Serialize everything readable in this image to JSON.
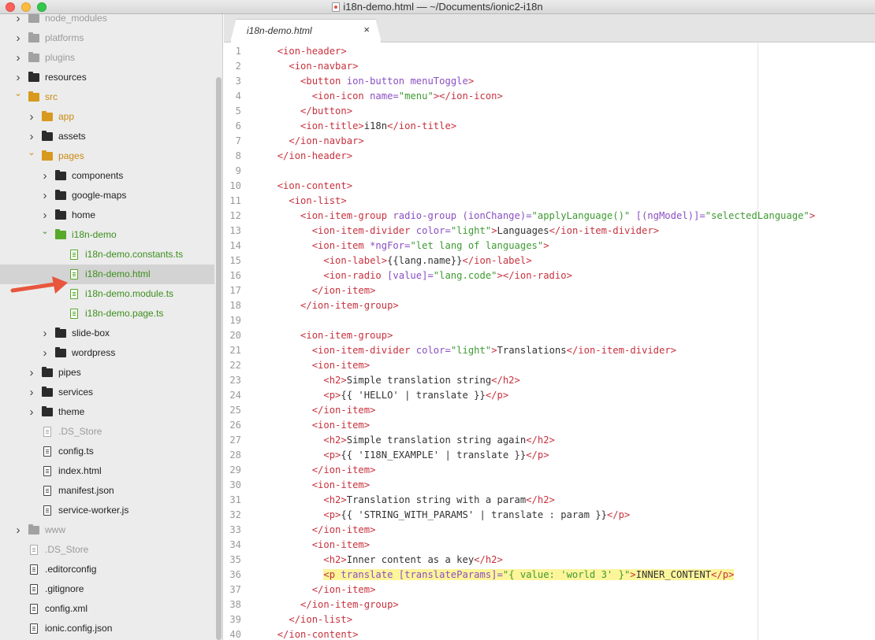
{
  "window": {
    "title": "i18n-demo.html — ~/Documents/ionic2-i18n"
  },
  "sidebar": {
    "items": [
      {
        "label": "node_modules",
        "kind": "folder",
        "color": "grey",
        "depth": 1,
        "chevron": "right"
      },
      {
        "label": "platforms",
        "kind": "folder",
        "color": "grey",
        "depth": 1,
        "chevron": "right"
      },
      {
        "label": "plugins",
        "kind": "folder",
        "color": "grey",
        "depth": 1,
        "chevron": "right"
      },
      {
        "label": "resources",
        "kind": "folder",
        "color": "dark",
        "depth": 1,
        "chevron": "right"
      },
      {
        "label": "src",
        "kind": "folder",
        "color": "gold",
        "depth": 1,
        "chevron": "down"
      },
      {
        "label": "app",
        "kind": "folder",
        "color": "gold",
        "depth": 2,
        "chevron": "right"
      },
      {
        "label": "assets",
        "kind": "folder",
        "color": "dark",
        "depth": 2,
        "chevron": "right"
      },
      {
        "label": "pages",
        "kind": "folder",
        "color": "gold",
        "depth": 2,
        "chevron": "down"
      },
      {
        "label": "components",
        "kind": "folder",
        "color": "dark",
        "depth": 3,
        "chevron": "right"
      },
      {
        "label": "google-maps",
        "kind": "folder",
        "color": "dark",
        "depth": 3,
        "chevron": "right"
      },
      {
        "label": "home",
        "kind": "folder",
        "color": "dark",
        "depth": 3,
        "chevron": "right"
      },
      {
        "label": "i18n-demo",
        "kind": "folder",
        "color": "green",
        "depth": 3,
        "chevron": "down"
      },
      {
        "label": "i18n-demo.constants.ts",
        "kind": "file",
        "color": "green",
        "depth": 4
      },
      {
        "label": "i18n-demo.html",
        "kind": "file",
        "color": "green",
        "depth": 4,
        "selected": true
      },
      {
        "label": "i18n-demo.module.ts",
        "kind": "file",
        "color": "green",
        "depth": 4
      },
      {
        "label": "i18n-demo.page.ts",
        "kind": "file",
        "color": "green",
        "depth": 4
      },
      {
        "label": "slide-box",
        "kind": "folder",
        "color": "dark",
        "depth": 3,
        "chevron": "right"
      },
      {
        "label": "wordpress",
        "kind": "folder",
        "color": "dark",
        "depth": 3,
        "chevron": "right"
      },
      {
        "label": "pipes",
        "kind": "folder",
        "color": "dark",
        "depth": 2,
        "chevron": "right"
      },
      {
        "label": "services",
        "kind": "folder",
        "color": "dark",
        "depth": 2,
        "chevron": "right"
      },
      {
        "label": "theme",
        "kind": "folder",
        "color": "dark",
        "depth": 2,
        "chevron": "right"
      },
      {
        "label": ".DS_Store",
        "kind": "file",
        "color": "grey",
        "depth": 2
      },
      {
        "label": "config.ts",
        "kind": "file",
        "color": "dark",
        "depth": 2
      },
      {
        "label": "index.html",
        "kind": "file",
        "color": "dark",
        "depth": 2
      },
      {
        "label": "manifest.json",
        "kind": "file",
        "color": "dark",
        "depth": 2
      },
      {
        "label": "service-worker.js",
        "kind": "file",
        "color": "dark",
        "depth": 2
      },
      {
        "label": "www",
        "kind": "folder",
        "color": "grey",
        "depth": 1,
        "chevron": "right"
      },
      {
        "label": ".DS_Store",
        "kind": "file",
        "color": "grey",
        "depth": 1
      },
      {
        "label": ".editorconfig",
        "kind": "file",
        "color": "dark",
        "depth": 1
      },
      {
        "label": ".gitignore",
        "kind": "file",
        "color": "dark",
        "depth": 1
      },
      {
        "label": "config.xml",
        "kind": "file",
        "color": "dark",
        "depth": 1
      },
      {
        "label": "ionic.config.json",
        "kind": "file",
        "color": "dark",
        "depth": 1
      }
    ]
  },
  "tabs": [
    {
      "label": "i18n-demo.html",
      "close": "×"
    }
  ],
  "editor": {
    "lines": [
      {
        "n": "1",
        "tokens": [
          [
            "",
            "  "
          ],
          [
            "t",
            "<ion-header>"
          ]
        ]
      },
      {
        "n": "2",
        "tokens": [
          [
            "",
            "    "
          ],
          [
            "t",
            "<ion-navbar>"
          ]
        ]
      },
      {
        "n": "3",
        "tokens": [
          [
            "",
            "      "
          ],
          [
            "t",
            "<button"
          ],
          [
            "a",
            " ion-button menuToggle"
          ],
          [
            "t",
            ">"
          ]
        ]
      },
      {
        "n": "4",
        "tokens": [
          [
            "",
            "        "
          ],
          [
            "t",
            "<ion-icon"
          ],
          [
            "a",
            " name="
          ],
          [
            "s",
            "\"menu\""
          ],
          [
            "t",
            "></ion-icon>"
          ]
        ]
      },
      {
        "n": "5",
        "tokens": [
          [
            "",
            "      "
          ],
          [
            "t",
            "</button>"
          ]
        ]
      },
      {
        "n": "6",
        "tokens": [
          [
            "",
            "      "
          ],
          [
            "t",
            "<ion-title>"
          ],
          [
            "",
            "i18n"
          ],
          [
            "t",
            "</ion-title>"
          ]
        ]
      },
      {
        "n": "7",
        "tokens": [
          [
            "",
            "    "
          ],
          [
            "t",
            "</ion-navbar>"
          ]
        ]
      },
      {
        "n": "8",
        "tokens": [
          [
            "",
            "  "
          ],
          [
            "t",
            "</ion-header>"
          ]
        ]
      },
      {
        "n": "9",
        "tokens": []
      },
      {
        "n": "10",
        "tokens": [
          [
            "",
            "  "
          ],
          [
            "t",
            "<ion-content>"
          ]
        ]
      },
      {
        "n": "11",
        "tokens": [
          [
            "",
            "    "
          ],
          [
            "t",
            "<ion-list>"
          ]
        ]
      },
      {
        "n": "12",
        "tokens": [
          [
            "",
            "      "
          ],
          [
            "t",
            "<ion-item-group"
          ],
          [
            "a",
            " radio-group (ionChange)="
          ],
          [
            "s",
            "\"applyLanguage()\""
          ],
          [
            "a",
            " [(ngModel)]="
          ],
          [
            "s",
            "\"selectedLanguage\""
          ],
          [
            "t",
            ">"
          ]
        ]
      },
      {
        "n": "13",
        "tokens": [
          [
            "",
            "        "
          ],
          [
            "t",
            "<ion-item-divider"
          ],
          [
            "a",
            " color="
          ],
          [
            "s",
            "\"light\""
          ],
          [
            "t",
            ">"
          ],
          [
            "",
            "Languages"
          ],
          [
            "t",
            "</ion-item-divider>"
          ]
        ]
      },
      {
        "n": "14",
        "tokens": [
          [
            "",
            "        "
          ],
          [
            "t",
            "<ion-item"
          ],
          [
            "a",
            " *ngFor="
          ],
          [
            "s",
            "\"let lang of languages\""
          ],
          [
            "t",
            ">"
          ]
        ]
      },
      {
        "n": "15",
        "tokens": [
          [
            "",
            "          "
          ],
          [
            "t",
            "<ion-label>"
          ],
          [
            "",
            "{{lang.name}}"
          ],
          [
            "t",
            "</ion-label>"
          ]
        ]
      },
      {
        "n": "16",
        "tokens": [
          [
            "",
            "          "
          ],
          [
            "t",
            "<ion-radio"
          ],
          [
            "a",
            " [value]="
          ],
          [
            "s",
            "\"lang.code\""
          ],
          [
            "t",
            "></ion-radio>"
          ]
        ]
      },
      {
        "n": "17",
        "tokens": [
          [
            "",
            "        "
          ],
          [
            "t",
            "</ion-item>"
          ]
        ]
      },
      {
        "n": "18",
        "tokens": [
          [
            "",
            "      "
          ],
          [
            "t",
            "</ion-item-group>"
          ]
        ]
      },
      {
        "n": "19",
        "tokens": []
      },
      {
        "n": "20",
        "tokens": [
          [
            "",
            "      "
          ],
          [
            "t",
            "<ion-item-group>"
          ]
        ]
      },
      {
        "n": "21",
        "tokens": [
          [
            "",
            "        "
          ],
          [
            "t",
            "<ion-item-divider"
          ],
          [
            "a",
            " color="
          ],
          [
            "s",
            "\"light\""
          ],
          [
            "t",
            ">"
          ],
          [
            "",
            "Translations"
          ],
          [
            "t",
            "</ion-item-divider>"
          ]
        ]
      },
      {
        "n": "22",
        "tokens": [
          [
            "",
            "        "
          ],
          [
            "t",
            "<ion-item>"
          ]
        ]
      },
      {
        "n": "23",
        "tokens": [
          [
            "",
            "          "
          ],
          [
            "t",
            "<h2>"
          ],
          [
            "",
            "Simple translation string"
          ],
          [
            "t",
            "</h2>"
          ]
        ]
      },
      {
        "n": "24",
        "tokens": [
          [
            "",
            "          "
          ],
          [
            "t",
            "<p>"
          ],
          [
            "",
            "{{ 'HELLO' | translate }}"
          ],
          [
            "t",
            "</p>"
          ]
        ]
      },
      {
        "n": "25",
        "tokens": [
          [
            "",
            "        "
          ],
          [
            "t",
            "</ion-item>"
          ]
        ]
      },
      {
        "n": "26",
        "tokens": [
          [
            "",
            "        "
          ],
          [
            "t",
            "<ion-item>"
          ]
        ]
      },
      {
        "n": "27",
        "tokens": [
          [
            "",
            "          "
          ],
          [
            "t",
            "<h2>"
          ],
          [
            "",
            "Simple translation string again"
          ],
          [
            "t",
            "</h2>"
          ]
        ]
      },
      {
        "n": "28",
        "tokens": [
          [
            "",
            "          "
          ],
          [
            "t",
            "<p>"
          ],
          [
            "",
            "{{ 'I18N_EXAMPLE' | translate }}"
          ],
          [
            "t",
            "</p>"
          ]
        ]
      },
      {
        "n": "29",
        "tokens": [
          [
            "",
            "        "
          ],
          [
            "t",
            "</ion-item>"
          ]
        ]
      },
      {
        "n": "30",
        "tokens": [
          [
            "",
            "        "
          ],
          [
            "t",
            "<ion-item>"
          ]
        ]
      },
      {
        "n": "31",
        "tokens": [
          [
            "",
            "          "
          ],
          [
            "t",
            "<h2>"
          ],
          [
            "",
            "Translation string with a param"
          ],
          [
            "t",
            "</h2>"
          ]
        ]
      },
      {
        "n": "32",
        "tokens": [
          [
            "",
            "          "
          ],
          [
            "t",
            "<p>"
          ],
          [
            "",
            "{{ 'STRING_WITH_PARAMS' | translate : param }}"
          ],
          [
            "t",
            "</p>"
          ]
        ]
      },
      {
        "n": "33",
        "tokens": [
          [
            "",
            "        "
          ],
          [
            "t",
            "</ion-item>"
          ]
        ]
      },
      {
        "n": "34",
        "tokens": [
          [
            "",
            "        "
          ],
          [
            "t",
            "<ion-item>"
          ]
        ]
      },
      {
        "n": "35",
        "tokens": [
          [
            "",
            "          "
          ],
          [
            "t",
            "<h2>"
          ],
          [
            "",
            "Inner content as a key"
          ],
          [
            "t",
            "</h2>"
          ]
        ]
      },
      {
        "n": "36",
        "highlight": true,
        "tokens": [
          [
            "",
            "          "
          ],
          [
            "t",
            "<p"
          ],
          [
            "a",
            " translate [translateParams]="
          ],
          [
            "s",
            "\"{ value: 'world 3' }\""
          ],
          [
            "t",
            ">"
          ],
          [
            "",
            "INNER_CONTENT"
          ],
          [
            "t",
            "</p>"
          ]
        ]
      },
      {
        "n": "37",
        "tokens": [
          [
            "",
            "        "
          ],
          [
            "t",
            "</ion-item>"
          ]
        ]
      },
      {
        "n": "38",
        "tokens": [
          [
            "",
            "      "
          ],
          [
            "t",
            "</ion-item-group>"
          ]
        ]
      },
      {
        "n": "39",
        "tokens": [
          [
            "",
            "    "
          ],
          [
            "t",
            "</ion-list>"
          ]
        ]
      },
      {
        "n": "40",
        "tokens": [
          [
            "",
            "  "
          ],
          [
            "t",
            "</ion-content>"
          ]
        ]
      }
    ]
  },
  "colors": {
    "tag": "#c7323e",
    "attr": "#8a4fc1",
    "string": "#3f9a33",
    "highlight": "#fdf59a",
    "arrow": "#e8563d"
  }
}
